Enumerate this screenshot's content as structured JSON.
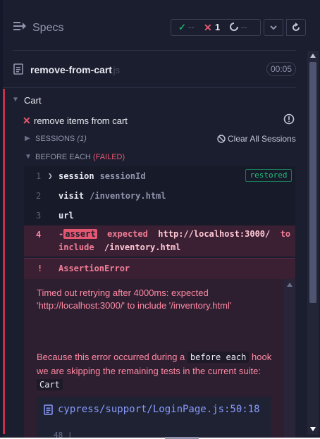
{
  "header": {
    "title": "Specs",
    "stats": {
      "passed_value": "--",
      "failed_value": "1",
      "pending_value": "--"
    }
  },
  "spec_file": {
    "name": "remove-from-cart",
    "extension": ".js",
    "duration": "00:05"
  },
  "suite": {
    "name": "Cart",
    "test": {
      "name": "remove items from cart",
      "sessions_label": "SESSIONS",
      "sessions_count": "(1)",
      "clear_sessions_label": "Clear All Sessions",
      "before_each_label": "BEFORE EACH",
      "before_each_status": "(FAILED)"
    }
  },
  "commands": [
    {
      "num": "1",
      "name": "session",
      "message": "sessionId",
      "badge": "restored"
    },
    {
      "num": "2",
      "name": "visit",
      "message": "/inventory.html"
    },
    {
      "num": "3",
      "name": "url",
      "message": ""
    }
  ],
  "failed_command": {
    "num": "4",
    "prefix": "-",
    "name": "assert",
    "text_a": "expected",
    "url": "http://localhost:3000/",
    "text_b": "to",
    "text_c": "include",
    "path": "/inventory.html"
  },
  "error": {
    "bang": "!",
    "type": "AssertionError",
    "message": "Timed out retrying after 4000ms: expected 'http://localhost:3000/' to include '/inventory.html'",
    "hook_msg_1": "Because this error occurred during a",
    "hook_code_1": "before each",
    "hook_msg_2": "hook we are skipping the remaining tests in the current suite:",
    "hook_code_2": "Cart",
    "codeframe_path": "cypress/support/LoginPage.js:50:18",
    "codeframe_line": "48 |"
  },
  "colors": {
    "background": "#1b1e2e",
    "fail": "#e45770",
    "pass": "#1fa971",
    "link": "#8a9bff"
  },
  "icons": [
    "specs-list-icon",
    "check-icon",
    "x-icon",
    "pending-icon",
    "chevron-down-icon",
    "reload-icon",
    "document-icon",
    "info-icon",
    "no-entry-icon"
  ]
}
